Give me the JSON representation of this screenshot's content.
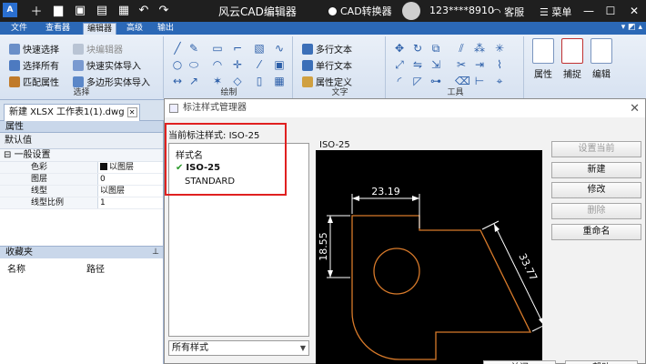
{
  "titlebar": {
    "app_logo": "A",
    "title": "风云CAD编辑器",
    "cad_converter": "CAD转换器",
    "phone": "123****8910",
    "service": "客服",
    "menu": "菜单",
    "icons": [
      "folder-icon",
      "save-icon",
      "print-icon",
      "undo-icon",
      "redo-icon"
    ]
  },
  "tabs": [
    "文件",
    "查看器",
    "编辑器",
    "高级",
    "输出"
  ],
  "active_tab": "编辑器",
  "ribbon": {
    "select_group": {
      "title": "选择",
      "items": [
        "快速选择",
        "块编辑器",
        "选择所有",
        "快速实体导入",
        "匹配属性",
        "多边形实体导入"
      ]
    },
    "draw_group": {
      "title": "绘制"
    },
    "text_group": {
      "title": "文字",
      "items": [
        "多行文本",
        "单行文本",
        "属性定义"
      ]
    },
    "tools_group": {
      "title": "工具"
    },
    "big_buttons": [
      "属性",
      "捕捉",
      "编辑"
    ]
  },
  "doc_tab": {
    "label": "新建 XLSX 工作表1(1).dwg"
  },
  "properties": {
    "header": "属性",
    "default_value": "默认值",
    "section": "一般设置",
    "rows": [
      {
        "key": "色彩",
        "value": "以图层"
      },
      {
        "key": "图层",
        "value": "0"
      },
      {
        "key": "线型",
        "value": "以图层"
      },
      {
        "key": "线型比例",
        "value": "1"
      }
    ]
  },
  "favorites": {
    "header": "收藏夹",
    "col_name": "名称",
    "col_path": "路径"
  },
  "dialog": {
    "title": "标注样式管理器",
    "current_style_label": "当前标注样式:",
    "current_style": "ISO-25",
    "list_header": "样式名",
    "styles": [
      "ISO-25",
      "STANDARD"
    ],
    "selected_style": "ISO-25",
    "filter": "所有样式",
    "preview_label": "ISO-25",
    "buttons": [
      {
        "label": "设置当前",
        "enabled": false
      },
      {
        "label": "新建",
        "enabled": true
      },
      {
        "label": "修改",
        "enabled": true
      },
      {
        "label": "删除",
        "enabled": false
      },
      {
        "label": "重命名",
        "enabled": true
      }
    ],
    "bottom_buttons": [
      "关闭",
      "帮助"
    ]
  },
  "preview_dims": {
    "top": "23.19",
    "left": "18.55",
    "right": "33.77"
  },
  "colors": {
    "titlebar": "#1f1f1f",
    "ribbon_tabs": "#2b68b6",
    "highlight_box": "#e02020",
    "preview_bg": "#000000",
    "shape_stroke": "#d87a2a",
    "dimension_stroke": "#ffffff",
    "check": "#2a9a2a"
  }
}
